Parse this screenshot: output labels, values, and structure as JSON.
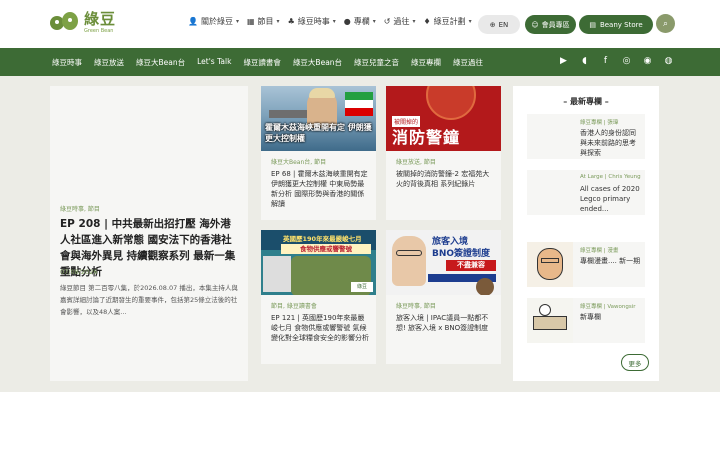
{
  "header": {
    "logo_cn": "綠豆",
    "logo_en": "Green Bean",
    "nav": [
      {
        "icon": "person-icon",
        "glyph": "👤",
        "label": "關於綠豆"
      },
      {
        "icon": "video-icon",
        "glyph": "▦",
        "label": "節目"
      },
      {
        "icon": "tree-icon",
        "glyph": "♣",
        "label": "綠豆時事"
      },
      {
        "icon": "chat-icon",
        "glyph": "●",
        "label": "專欄"
      },
      {
        "icon": "history-icon",
        "glyph": "↺",
        "label": "過往"
      },
      {
        "icon": "bulb-icon",
        "glyph": "♦",
        "label": "綠豆計劃"
      }
    ],
    "lang_label": "EN",
    "member_label": "會員專區",
    "store_label": "Beany Store"
  },
  "navbar": {
    "links": [
      "綠豆時事",
      "綠豆放送",
      "綠豆大Bean台",
      "Let's Talk",
      "綠豆讀書會",
      "綠豆大Bean台",
      "綠豆兒童之音",
      "綠豆專欄",
      "綠豆過往"
    ],
    "social": [
      {
        "name": "youtube-icon",
        "glyph": "▶"
      },
      {
        "name": "patreon-icon",
        "glyph": "◖"
      },
      {
        "name": "facebook-icon",
        "glyph": "f"
      },
      {
        "name": "instagram-icon",
        "glyph": "◎"
      },
      {
        "name": "spotify-icon",
        "glyph": "◉"
      },
      {
        "name": "podcast-icon",
        "glyph": "◍"
      }
    ]
  },
  "feature": {
    "category": "綠豆時事, 節目",
    "title": "EP 208 | 中共最新出招打壓 海外港人社區進入新常態 國安法下的香港社會與海外異見 持續觀察系列 最新一集重點分析",
    "date": "07/08/2026",
    "excerpt": "綠豆節目 第二百零八集，於2026.08.07 播出，本集主持人與嘉賓詳細討論了近期發生的重要事件，包括第25條立法後的社會影響，以及48人案..."
  },
  "cards": [
    {
      "category": "綠豆大Bean台, 節目",
      "title": "EP 68 | 霍爾木茲海峽重開有定 伊朗獲更大控制權 中東局勢最新分析 國際形勢與香港的關係解讀",
      "thumb_caption": "霍爾木茲海峽重開有定 伊朗獲更大控制權"
    },
    {
      "category": "綠豆放送, 節目",
      "title": "被關掉的消防警鐘-2 宏福苑大火的背後真相 系列紀錄片",
      "thumb_tag": "被關掉的",
      "thumb_big": "消防警鐘"
    },
    {
      "category": "節目, 綠豆讀書會",
      "title": "EP 121 | 英國歷190年來最嚴峻七月 食物供應或響警號 氣候變化對全球糧食安全的影響分析",
      "thumb_title": "英國歷190年來最嚴峻七月",
      "thumb_banner": "食物供應或響警號",
      "thumb_badge": "綠豆"
    },
    {
      "category": "綠豆時事, 節目",
      "title": "旅客入境 | IPAC議員一點都不想! 旅客入境 x BNO簽證制度",
      "thumb_head1": "旅客入境",
      "thumb_head2": "BNO簽證制度",
      "thumb_red": "不盡兼容"
    }
  ],
  "sidebar": {
    "heading": "– 最新專欄 –",
    "items": [
      {
        "category": "綠豆專欄 | 張瑋",
        "title": "香港人的身份認同 與未來前路的思考與探索"
      },
      {
        "category": "At Large | Chris Yeung",
        "title": "All cases of 2020 Legco primary ended..."
      },
      {
        "category": "綠豆專欄 | 漫畫",
        "title": "專欄漫畫.... 新一期"
      },
      {
        "category": "綠豆專欄 | Vawongsir",
        "title": "新專欄"
      }
    ],
    "more_label": "更多"
  }
}
